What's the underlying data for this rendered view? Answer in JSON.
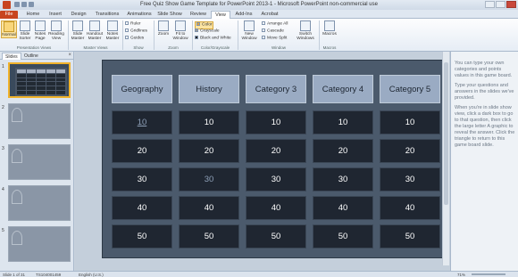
{
  "window": {
    "title": "Free Quiz Show Game Template for PowerPoint 2013-1 - Microsoft PowerPoint non-commercial use"
  },
  "tabs": [
    "File",
    "Home",
    "Insert",
    "Design",
    "Transitions",
    "Animations",
    "Slide Show",
    "Review",
    "View",
    "Add-Ins",
    "Acrobat"
  ],
  "ribbon": {
    "presentation_views": [
      "Normal",
      "Slide Sorter",
      "Notes Page",
      "Reading View"
    ],
    "master_views": [
      "Slide Master",
      "Handout Master",
      "Notes Master"
    ],
    "show": [
      "Ruler",
      "Gridlines",
      "Guides"
    ],
    "zoom": [
      "Zoom",
      "Fit to Window"
    ],
    "color": [
      "Color",
      "Grayscale",
      "Black and White"
    ],
    "window": [
      "New Window",
      "Arrange All",
      "Cascade",
      "Move Split",
      "Switch Windows"
    ],
    "macros": "Macros",
    "groups": [
      "Presentation Views",
      "Master Views",
      "Show",
      "Zoom",
      "Color/Grayscale",
      "Window",
      "Macros"
    ]
  },
  "left_panel": {
    "tabs": [
      "Slides",
      "Outline"
    ],
    "close": "×",
    "thumb_numbers": [
      "1",
      "2",
      "3",
      "4",
      "5"
    ]
  },
  "board": {
    "categories": [
      "Geography",
      "History",
      "Category 3",
      "Category 4",
      "Category 5"
    ],
    "values": [
      "10",
      "20",
      "30",
      "40",
      "50"
    ]
  },
  "notes": [
    "You can type your own categories and points values in this game board.",
    "Type your questions and answers in the slides we've provided.",
    "When you're in slide show view, click a dark box to go to that question, then click the large letter A graphic to reveal the answer. Click the triangle to return to this game board slide."
  ],
  "status": {
    "slide": "Slide 1 of 31",
    "theme": "TS104001459",
    "language": "English (U.S.)",
    "zoom": "71%"
  }
}
